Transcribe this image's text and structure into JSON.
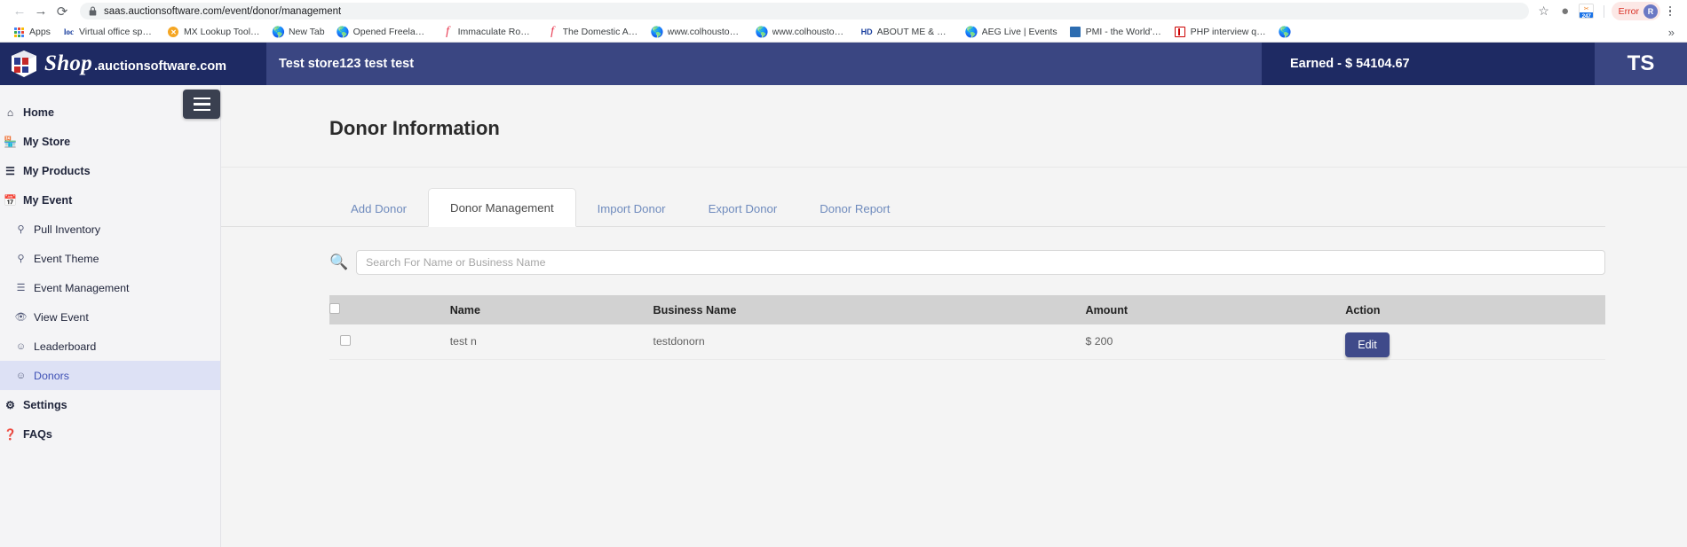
{
  "browser": {
    "back_icon": "back-arrow-icon",
    "forward_icon": "forward-arrow-icon",
    "reload_icon": "reload-icon",
    "lock_icon": "lock-icon",
    "url": "saas.auctionsoftware.com/event/donor/management",
    "url_domain": "saas.auctionsoftware.com",
    "url_path": "/event/donor/management",
    "star_icon": "bookmark-star-icon",
    "profile_error_label": "Error",
    "profile_initial": "R",
    "menu_icon": "kebab-menu-icon",
    "ext_247_top": "✂",
    "ext_247_bottom": "247",
    "bookmarks_overflow": "»",
    "bookmarks": [
      {
        "label": "Apps",
        "icon": "apps-grid-icon"
      },
      {
        "label": "Virtual office space...",
        "icon": "loc-icon"
      },
      {
        "label": "MX Lookup Tool - C...",
        "icon": "mx-circle-icon"
      },
      {
        "label": "New Tab",
        "icon": "globe-icon"
      },
      {
        "label": "Opened Freelance J...",
        "icon": "globe-icon"
      },
      {
        "label": "Immaculate Roofing |",
        "icon": "freelancer-f-icon"
      },
      {
        "label": "The Domestic Agen...",
        "icon": "freelancer-f-icon"
      },
      {
        "label": "www.colhouston.or...",
        "icon": "globe-icon"
      },
      {
        "label": "www.colhouston.or...",
        "icon": "globe-icon"
      },
      {
        "label": "ABOUT ME & MY P...",
        "icon": "hd-icon"
      },
      {
        "label": "AEG Live | Events",
        "icon": "globe-icon"
      },
      {
        "label": "PMI - the World's L...",
        "icon": "pmi-icon"
      },
      {
        "label": "PHP interview ques...",
        "icon": "php-icon"
      },
      {
        "label": "",
        "icon": "globe-icon"
      }
    ]
  },
  "header": {
    "logo_icon": "shop-cube-logo-icon",
    "logo_shop": "Shop",
    "logo_domain": ".auctionsoftware.com",
    "store_name": "Test store123 test test",
    "earned_label": "Earned - $ 54104.67",
    "user_initials": "TS",
    "bg_dark": "#1e2a63",
    "bg_mid": "#3a4682"
  },
  "sidebar": {
    "hamburger_icon": "hamburger-menu-icon",
    "items": [
      {
        "label": "Home",
        "icon": "home-icon",
        "sub": false,
        "active": false
      },
      {
        "label": "My Store",
        "icon": "store-icon",
        "sub": false,
        "active": false
      },
      {
        "label": "My Products",
        "icon": "layers-icon",
        "sub": false,
        "active": false
      },
      {
        "label": "My Event",
        "icon": "calendar-icon",
        "sub": false,
        "active": false
      },
      {
        "label": "Pull Inventory",
        "icon": "pin-icon",
        "sub": true,
        "active": false
      },
      {
        "label": "Event Theme",
        "icon": "pin-icon",
        "sub": true,
        "active": false
      },
      {
        "label": "Event Management",
        "icon": "layers-icon",
        "sub": true,
        "active": false
      },
      {
        "label": "View Event",
        "icon": "eye-icon",
        "sub": true,
        "active": false
      },
      {
        "label": "Leaderboard",
        "icon": "user-icon",
        "sub": true,
        "active": false
      },
      {
        "label": "Donors",
        "icon": "user-icon",
        "sub": true,
        "active": true
      },
      {
        "label": "Settings",
        "icon": "gear-icon",
        "sub": false,
        "active": false
      },
      {
        "label": "FAQs",
        "icon": "question-icon",
        "sub": false,
        "active": false
      }
    ],
    "active_color": "#3f51b5"
  },
  "main": {
    "page_title": "Donor Information",
    "tabs": [
      {
        "label": "Add Donor",
        "active": false
      },
      {
        "label": "Donor Management",
        "active": true
      },
      {
        "label": "Import Donor",
        "active": false
      },
      {
        "label": "Export Donor",
        "active": false
      },
      {
        "label": "Donor Report",
        "active": false
      }
    ],
    "search": {
      "icon": "search-icon",
      "placeholder": "Search For Name or Business Name",
      "value": ""
    },
    "table": {
      "columns": [
        "",
        "Name",
        "Business Name",
        "Amount",
        "Action"
      ],
      "rows": [
        {
          "checked": false,
          "name": "test n",
          "business_name": "testdonorn",
          "amount": "$ 200",
          "action_label": "Edit"
        }
      ]
    },
    "edit_button_color": "#3f4a8a"
  }
}
